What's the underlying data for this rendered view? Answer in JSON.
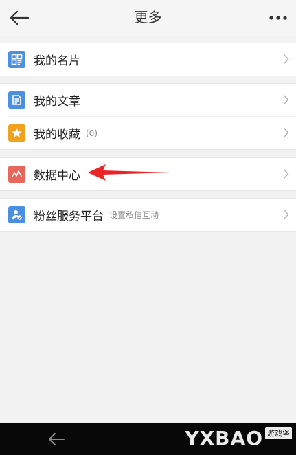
{
  "header": {
    "title": "更多",
    "back_icon": "back-arrow-icon",
    "more_icon": "more-dots-icon"
  },
  "groups": [
    {
      "items": [
        {
          "label": "我的名片",
          "sub": "",
          "icon": "card-icon",
          "icon_color": "#4a8fe0"
        }
      ]
    },
    {
      "items": [
        {
          "label": "我的文章",
          "sub": "",
          "icon": "article-icon",
          "icon_color": "#4a8fe0"
        },
        {
          "label": "我的收藏",
          "sub": "(0)",
          "icon": "star-icon",
          "icon_color": "#f0a21e"
        }
      ]
    },
    {
      "items": [
        {
          "label": "数据中心",
          "sub": "",
          "icon": "chart-icon",
          "icon_color": "#e8675c"
        }
      ]
    },
    {
      "items": [
        {
          "label": "粉丝服务平台",
          "sub": "设置私信互动",
          "icon": "fans-service-icon",
          "icon_color": "#4a8fe0"
        }
      ]
    }
  ],
  "annotation": {
    "color": "#e8262a"
  },
  "navbar": {
    "back_icon": "nav-back-icon"
  },
  "watermark": {
    "text": "YXBAO",
    "tag": "游戏堡"
  }
}
